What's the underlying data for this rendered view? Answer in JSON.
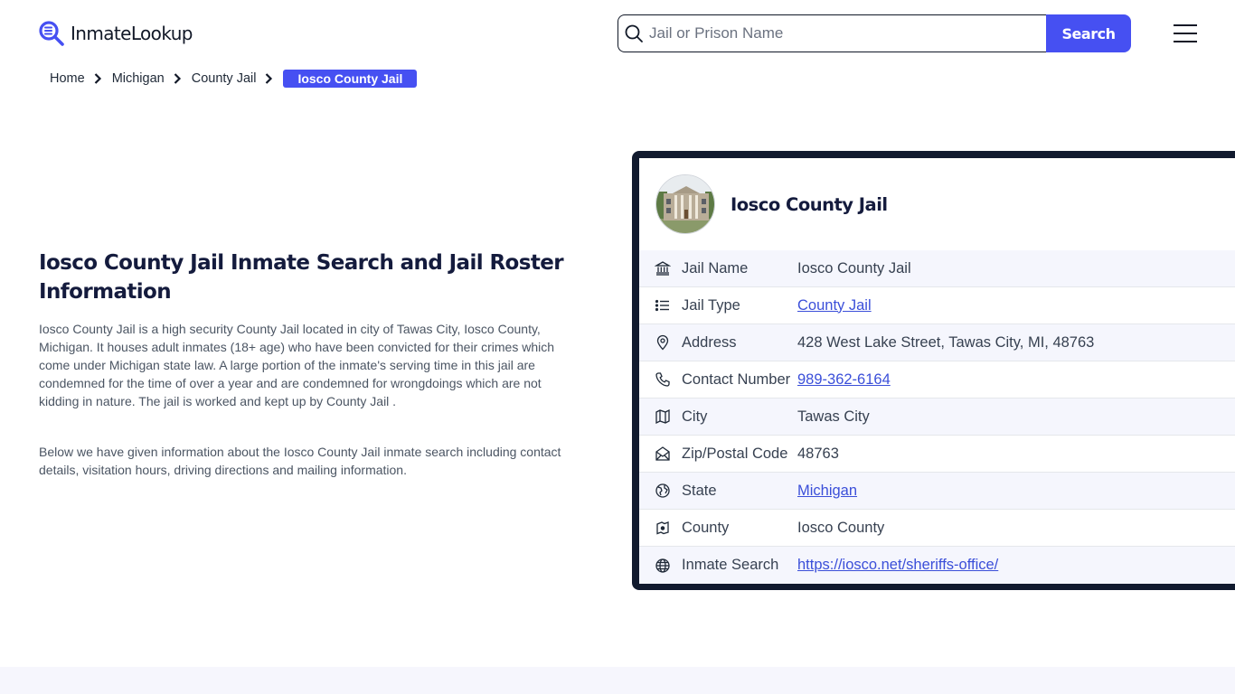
{
  "header": {
    "logo_text": "InmateLookup",
    "search_placeholder": "Jail or Prison Name",
    "search_value": "",
    "search_button": "Search",
    "menu_icon": "hamburger-menu-icon"
  },
  "breadcrumb": {
    "items": [
      "Home",
      "Michigan",
      "County Jail"
    ],
    "current": "Iosco County Jail"
  },
  "main": {
    "title": "Iosco County Jail Inmate Search and Jail Roster Information",
    "paragraphs": [
      "Iosco County Jail is a high security County Jail located in city of Tawas City, Iosco County, Michigan. It houses adult inmates (18+ age) who have been convicted for their crimes which come under Michigan state law. A large portion of the inmate's serving time in this jail are condemned for the time of over a year and are condemned for wrongdoings which are not kidding in nature. The jail is worked and kept up by County Jail .",
      "Below we have given information about the Iosco County Jail inmate search including contact details, visitation hours, driving directions and mailing information."
    ]
  },
  "card": {
    "title": "Iosco County Jail",
    "image_alt": "Iosco County Jail building",
    "rows": [
      {
        "icon": "building-columns-icon",
        "label": "Jail Name",
        "value": "Iosco County Jail",
        "link": false
      },
      {
        "icon": "list-icon",
        "label": "Jail Type",
        "value": "County Jail",
        "link": true
      },
      {
        "icon": "map-pin-icon",
        "label": "Address",
        "value": "428 West Lake Street, Tawas City, MI, 48763",
        "link": false
      },
      {
        "icon": "phone-icon",
        "label": "Contact Number",
        "value": "989-362-6164",
        "link": true
      },
      {
        "icon": "map-icon",
        "label": "City",
        "value": "Tawas City",
        "link": false
      },
      {
        "icon": "mail-open-icon",
        "label": "Zip/Postal Code",
        "value": "48763",
        "link": false
      },
      {
        "icon": "world-icon",
        "label": "State",
        "value": "Michigan",
        "link": true
      },
      {
        "icon": "county-map-icon",
        "label": "County",
        "value": "Iosco County",
        "link": false
      },
      {
        "icon": "globe-icon",
        "label": "Inmate Search",
        "value": "https://iosco.net/sheriffs-office/",
        "link": true
      }
    ]
  },
  "colors": {
    "accent": "#4650f2",
    "heading": "#141b3d",
    "card_border": "#111a2e",
    "link": "#3b4fd9",
    "row_alt": "#f5f6fd"
  }
}
